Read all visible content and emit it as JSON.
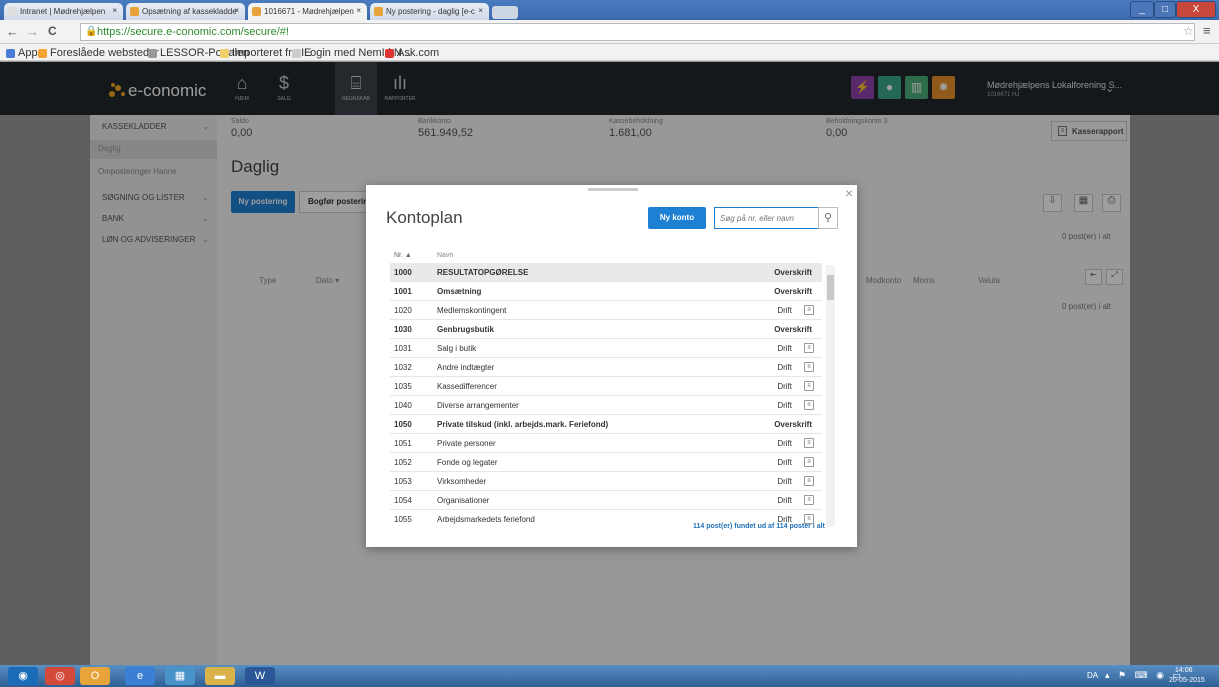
{
  "browser": {
    "tabs": [
      {
        "title": "Intranet | Mødrehjælpen",
        "fav": "#dddddd"
      },
      {
        "title": "Opsætning af kassekladde",
        "fav": "#e8a33b"
      },
      {
        "title": "1016671 - Mødrehjælpen",
        "fav": "#e8a33b"
      },
      {
        "title": "Ny postering - daglig [e-c",
        "fav": "#e8a33b"
      }
    ],
    "tab_close": "×",
    "url": "https://secure.e-conomic.com/secure/#!",
    "nav_back": "←",
    "nav_forward": "→",
    "nav_reload": "C",
    "star": "☆",
    "menu": "≡",
    "window_buttons": [
      "_",
      "□",
      "X"
    ],
    "bookmarks": [
      {
        "label": "Apps",
        "color": "#4a7bd6"
      },
      {
        "label": "Foreslåede websteder",
        "color": "#f4a331"
      },
      {
        "label": "LESSOR-Portalen",
        "color": "#999999"
      },
      {
        "label": "Importeret fra IE",
        "color": "#f2d06b"
      },
      {
        "label": "Login med NemId N...",
        "color": "#cccccc"
      },
      {
        "label": "Ask.com",
        "color": "#d33"
      }
    ]
  },
  "app": {
    "logo": "e-conomic",
    "nav": [
      {
        "icon": "⌂",
        "label": "HJEM"
      },
      {
        "icon": "$",
        "label": "SALG"
      },
      {
        "icon": "⌸",
        "label": "REGNSKAB"
      },
      {
        "icon": "ılı",
        "label": "RAPPORTER"
      }
    ],
    "header_icons": [
      {
        "name": "lightning-icon",
        "glyph": "⚡",
        "color": "#8e44ad"
      },
      {
        "name": "chat-icon",
        "glyph": "●",
        "color": "#3aaa8c"
      },
      {
        "name": "book-icon",
        "glyph": "▥",
        "color": "#4caf7a"
      },
      {
        "name": "gear-icon",
        "glyph": "✹",
        "color": "#e8922b"
      }
    ],
    "company": "Mødrehjælpens Lokalforening S...",
    "company_id": "1016671 HJ",
    "dropdown": "⌄"
  },
  "sidebar": {
    "items": [
      {
        "label": "KASSEKLADDER",
        "chev": "⌄"
      },
      {
        "label": "Daglig"
      },
      {
        "label": "Omposteringer Hanne"
      },
      {
        "label": "SØGNING OG LISTER",
        "chev": "⌄"
      },
      {
        "label": "BANK",
        "chev": "⌄"
      },
      {
        "label": "LØN OG ADVISERINGER",
        "chev": "⌄"
      }
    ]
  },
  "balances": [
    {
      "label": "Saldo",
      "value": "0,00"
    },
    {
      "label": "Bankkonto",
      "value": "561.949,52"
    },
    {
      "label": "Kassebeholdning",
      "value": "1.681,00"
    },
    {
      "label": "Beholdningskonto 3",
      "value": "0,00"
    }
  ],
  "kasserapport": "Kasserapport",
  "page_title": "Daglig",
  "btn_ny_postering": "Ny postering",
  "btn_bogfor": "Bogfør posterin",
  "postings_count": "0 post(er) i alt",
  "columns": {
    "type": "Type",
    "dato": "Dato ▾",
    "modkonto": "Modkonto",
    "moms": "Moms",
    "valuta": "Valuta"
  },
  "modal": {
    "title": "Kontoplan",
    "new_button": "Ny konto",
    "search_placeholder": "Søg på nr. eller navn",
    "col_nr": "Nr. ▲",
    "col_navn": "Navn",
    "close": "×",
    "rows": [
      {
        "nr": "1000",
        "navn": "RESULTATOPGØRELSE",
        "type": "Overskrift",
        "bold": true,
        "sel": true
      },
      {
        "nr": "1001",
        "navn": "Omsætning",
        "type": "Overskrift",
        "bold": true
      },
      {
        "nr": "1020",
        "navn": "Medlemskontingent",
        "type": "Drift"
      },
      {
        "nr": "1030",
        "navn": "Genbrugsbutik",
        "type": "Overskrift",
        "bold": true
      },
      {
        "nr": "1031",
        "navn": "Salg i butik",
        "type": "Drift"
      },
      {
        "nr": "1032",
        "navn": "Andre indtægter",
        "type": "Drift"
      },
      {
        "nr": "1035",
        "navn": "Kassedifferencer",
        "type": "Drift"
      },
      {
        "nr": "1040",
        "navn": "Diverse arrangementer",
        "type": "Drift"
      },
      {
        "nr": "1050",
        "navn": "Private tilskud (inkl. arbejds.mark. Feriefond)",
        "type": "Overskrift",
        "bold": true
      },
      {
        "nr": "1051",
        "navn": "Private personer",
        "type": "Drift"
      },
      {
        "nr": "1052",
        "navn": "Fonde og legater",
        "type": "Drift"
      },
      {
        "nr": "1053",
        "navn": "Virksomheder",
        "type": "Drift"
      },
      {
        "nr": "1054",
        "navn": "Organisationer",
        "type": "Drift"
      },
      {
        "nr": "1055",
        "navn": "Arbejdsmarkedets feriefond",
        "type": "Drift"
      }
    ],
    "footer": "114 post(er) fundet ud af 114 poster i alt"
  },
  "taskbar": {
    "lang": "DA",
    "time": "14:06",
    "date": "20-05-2015",
    "tray": "▴ ⚑ ⌨ ◉ ▭",
    "apps": [
      {
        "name": "start-button",
        "glyph": "◉",
        "color": "#1a6bb8"
      },
      {
        "name": "chrome-icon",
        "glyph": "◎",
        "color": "#d34a3a"
      },
      {
        "name": "outlook-icon",
        "glyph": "O",
        "color": "#e8a33b"
      },
      {
        "name": "ie-icon",
        "glyph": "e",
        "color": "#3a7fd3"
      },
      {
        "name": "app-icon",
        "glyph": "▦",
        "color": "#4a93c9"
      },
      {
        "name": "explorer-icon",
        "glyph": "▬",
        "color": "#d9b24a"
      },
      {
        "name": "word-icon",
        "glyph": "W",
        "color": "#2b5797"
      }
    ]
  }
}
